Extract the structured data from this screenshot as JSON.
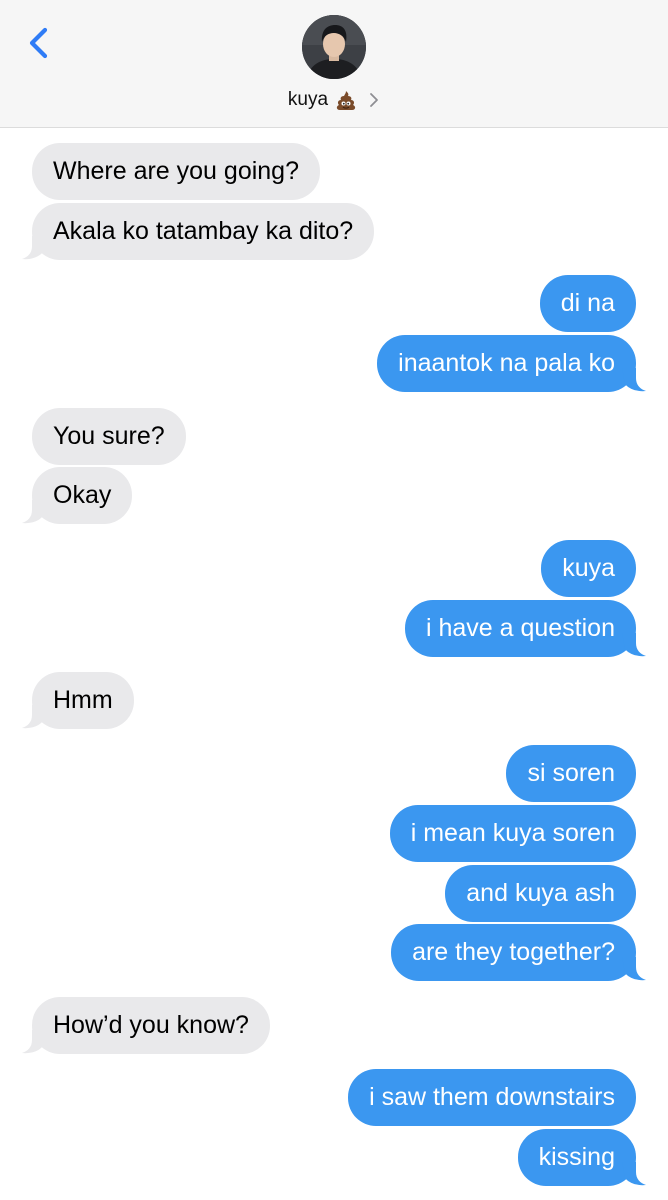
{
  "header": {
    "contact_name": "kuya",
    "contact_emoji": "pile-of-poo-emoji",
    "avatar": "profile-photo",
    "back_icon": "chevron-left-icon",
    "details_icon": "chevron-right-icon"
  },
  "colors": {
    "incoming_bubble": "#e9e9eb",
    "outgoing_bubble": "#3b97f0",
    "accent": "#2f7cf6",
    "header_bg": "#f6f6f6"
  },
  "messages": [
    {
      "direction": "in",
      "text": "Where are you going?"
    },
    {
      "direction": "in",
      "text": "Akala ko tatambay ka dito?"
    },
    {
      "direction": "out",
      "text": "di na"
    },
    {
      "direction": "out",
      "text": "inaantok na pala ko"
    },
    {
      "direction": "in",
      "text": "You sure?"
    },
    {
      "direction": "in",
      "text": "Okay"
    },
    {
      "direction": "out",
      "text": "kuya"
    },
    {
      "direction": "out",
      "text": "i have a question"
    },
    {
      "direction": "in",
      "text": "Hmm"
    },
    {
      "direction": "out",
      "text": "si soren"
    },
    {
      "direction": "out",
      "text": "i mean kuya soren"
    },
    {
      "direction": "out",
      "text": "and kuya ash"
    },
    {
      "direction": "out",
      "text": "are they together?"
    },
    {
      "direction": "in",
      "text": "How’d you know?"
    },
    {
      "direction": "out",
      "text": "i saw them downstairs"
    },
    {
      "direction": "out",
      "text": "kissing"
    }
  ]
}
